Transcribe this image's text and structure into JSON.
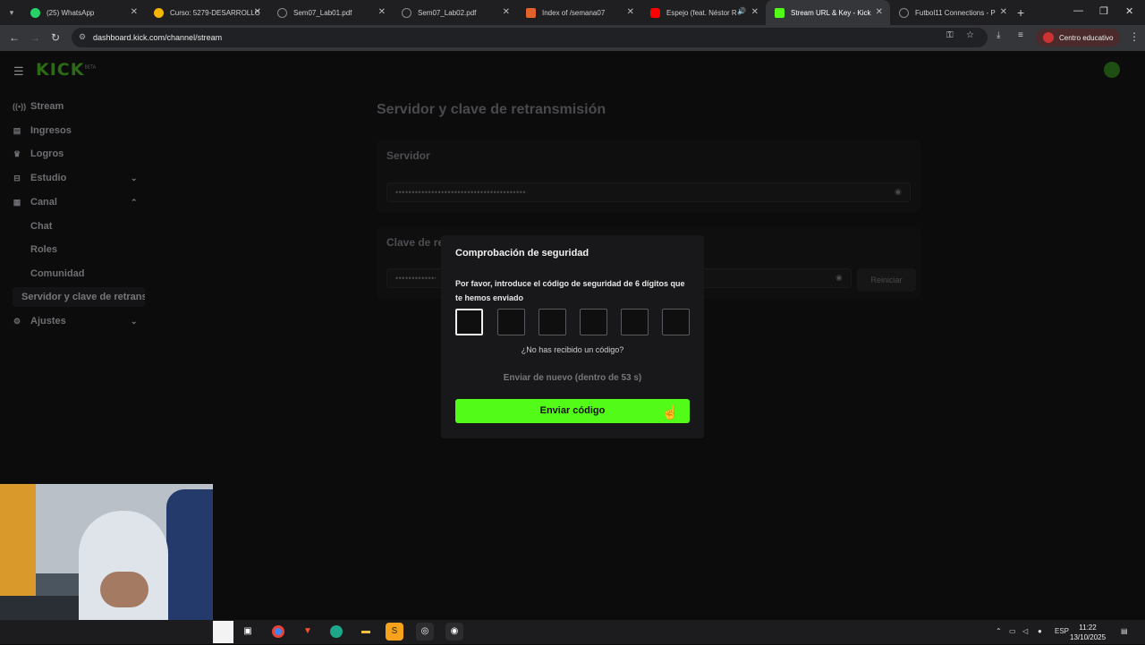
{
  "browser": {
    "tabs": [
      {
        "label": "(25) WhatsApp",
        "icon": "whatsapp-icon",
        "color": "#25d366"
      },
      {
        "label": "Curso: 5279-DESARROLLO",
        "icon": "course-icon",
        "color": "#f4b400"
      },
      {
        "label": "Sem07_Lab01.pdf",
        "icon": "globe-icon",
        "color": "#888888"
      },
      {
        "label": "Sem07_Lab02.pdf",
        "icon": "globe-icon",
        "color": "#888888"
      },
      {
        "label": "Index of /semana07",
        "icon": "folder-icon",
        "color": "#e0632b"
      },
      {
        "label": "Espejo (feat. Néstor R",
        "icon": "youtube-icon",
        "color": "#ff0000"
      },
      {
        "label": "Stream URL & Key - Kick",
        "icon": "kick-icon",
        "color": "#53fc18"
      },
      {
        "label": "Futbol11 Connections - P",
        "icon": "globe-icon",
        "color": "#888888"
      }
    ],
    "active_tab_index": 6,
    "url": "dashboard.kick.com/channel/stream",
    "profile_label": "Centro educativo"
  },
  "app": {
    "logo": "KICK",
    "logo_sup": "BETA"
  },
  "sidebar": {
    "items": [
      {
        "label": "Stream",
        "icon": "broadcast-icon"
      },
      {
        "label": "Ingresos",
        "icon": "wallet-icon"
      },
      {
        "label": "Logros",
        "icon": "trophy-icon"
      },
      {
        "label": "Estudio",
        "icon": "studio-icon",
        "chevron": "down"
      },
      {
        "label": "Canal",
        "icon": "channel-icon",
        "chevron": "up"
      }
    ],
    "canal_sub": [
      "Chat",
      "Roles",
      "Comunidad"
    ],
    "active_item": "Servidor y clave de retransmisión",
    "settings": {
      "label": "Ajustes",
      "icon": "gear-icon"
    }
  },
  "main": {
    "title": "Servidor y clave de retransmisión",
    "server_card": {
      "title": "Servidor",
      "value": "••••••••••••••••••••••••••••••••••••••••"
    },
    "key_card": {
      "title": "Clave de retransmisión",
      "value": "••••••••••••••••••••••••••••••••••••••••••••••••",
      "reset_label": "Reiniciar"
    }
  },
  "modal": {
    "title": "Comprobación de seguridad",
    "description": "Por favor, introduce el código de seguridad de 6 dígitos que te hemos enviado",
    "code_length": 6,
    "resend_question": "¿No has recibido un código?",
    "resend_timer": "Enviar de nuevo (dentro de 53 s)",
    "submit_label": "Enviar código"
  },
  "taskbar": {
    "apps": [
      "task-view-icon",
      "chrome-icon",
      "brave-icon",
      "edge-icon",
      "file-explorer-icon",
      "sublime-text-icon",
      "obs-icon",
      "recording-app-icon"
    ],
    "language": "ESP",
    "time": "11:22",
    "date": "13/10/2025"
  }
}
